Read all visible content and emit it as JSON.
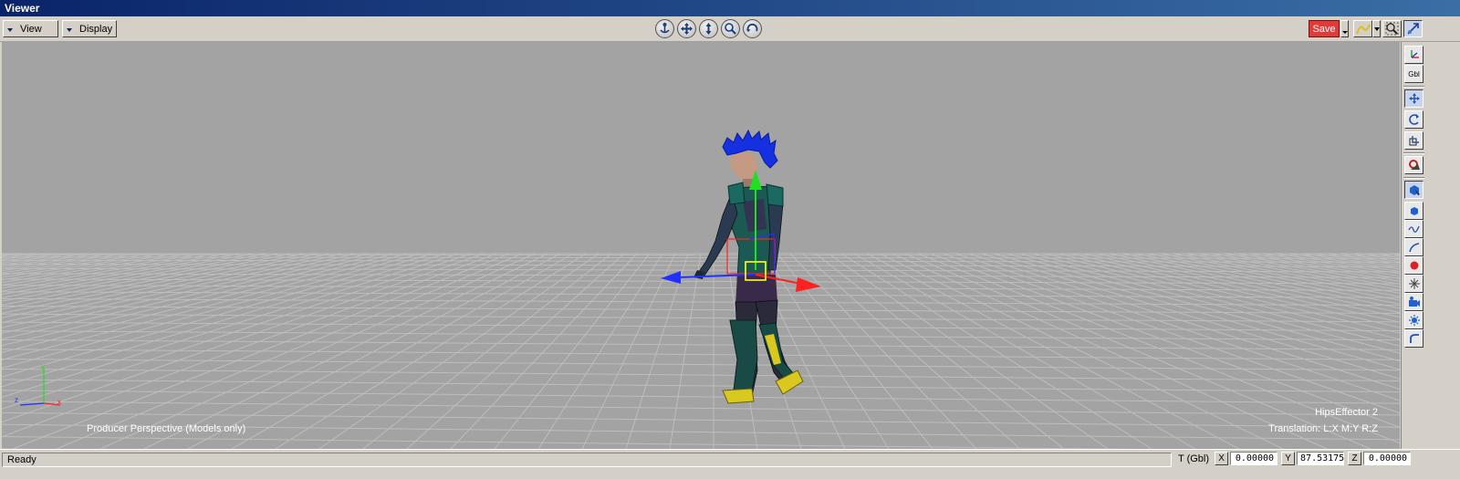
{
  "window": {
    "title": "Viewer"
  },
  "toolbar": {
    "view_menu_label": "View",
    "display_menu_label": "Display",
    "navigation_icons": [
      "anchor-icon",
      "pan-icon",
      "dolly-icon",
      "zoom-icon",
      "orbit-icon"
    ],
    "save_label": "Save",
    "right_icons": [
      "keying-mode-icon",
      "zoom-fit-icon",
      "pick-icon"
    ]
  },
  "viewport": {
    "camera_label": "Producer Perspective (Models only)",
    "selection_name": "HipsEffector 2",
    "transform_mode": "Translation: L:X M:Y R:Z",
    "background_color": "#a3a3a3",
    "grid_color": "#b8b8b8"
  },
  "right_toolbar": {
    "items": [
      "axis-widget-icon",
      "global-local-icon",
      "translate-tool-icon",
      "rotate-tool-icon",
      "scale-tool-icon",
      "manipulator-icon",
      "select-model-icon",
      "cube-model-icon",
      "curve-icon",
      "path-icon",
      "marker-icon",
      "null-icon",
      "camera-icon",
      "light-icon",
      "bend-icon"
    ],
    "global_label": "Gbl"
  },
  "status": {
    "text": "Ready",
    "transform_label": "T (Gbl)",
    "x_label": "X",
    "x_value": "0.00000",
    "y_label": "Y",
    "y_value": "87.53175",
    "z_label": "Z",
    "z_value": "0.00000"
  },
  "colors": {
    "x_axis": "#ff2020",
    "y_axis": "#20e020",
    "z_axis": "#2030ff",
    "save_button": "#e03a3a",
    "title_bar": "#0a246a"
  }
}
